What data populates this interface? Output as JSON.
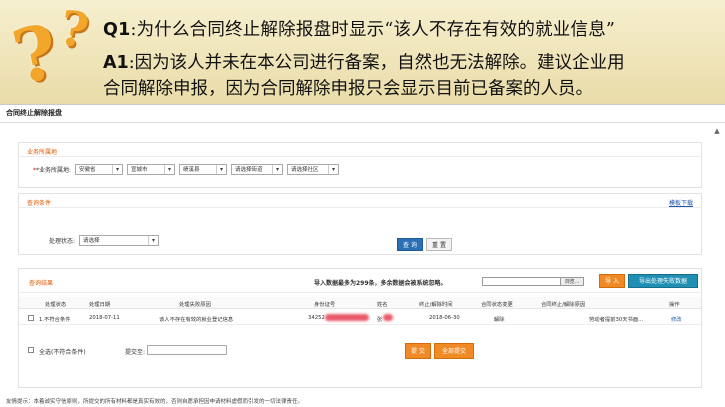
{
  "banner": {
    "q1_tag": "Q1",
    "q1_text": ":为什么合同终止解除报盘时显示“该人不存在有效的就业信息”",
    "a1_tag": "A1",
    "a1_text": ":因为该人并未在本公司进行备案，自然也无法解除。建议企业用",
    "a1_text2": "合同解除申报，因为合同解除申报只会显示目前已备案的人员。",
    "qmark": "?"
  },
  "page": {
    "tab_title": "合同终止解除报盘",
    "service_area": {
      "title": "业务所属地",
      "label": "*业务所属地:",
      "province": "安徽省",
      "city": "宣城市",
      "county": "绩溪县",
      "street_placeholder": "请选择街道",
      "community_placeholder": "请选择社区"
    },
    "query": {
      "title": "查询条件",
      "template_link": "模板下载",
      "status_label": "处理状态:",
      "status_value": "请选择",
      "query_button": "查 询",
      "reset_button": "重 置"
    },
    "results": {
      "title": "查询结果",
      "import_notice": "导入数据最多为299条，多余数据会被系统忽略。",
      "browse_button": "浏览...",
      "import_button": "导 入",
      "export_fail_button": "导出处理失败数据",
      "columns": [
        "处理状态",
        "处理日期",
        "处理失败原因",
        "身份证号",
        "姓名",
        "终止/解除时间",
        "合同状态变更",
        "合同终止/解除原因",
        "操作"
      ],
      "rows": [
        {
          "status": "1.不符合条件",
          "date": "2018-07-11",
          "reason": "该人不存在有效的就业登记信息",
          "id_prefix": "34252",
          "name_prefix": "张",
          "end_date": "2018-06-30",
          "change": "解除",
          "contract_reason": "劳动者提前30天书面...",
          "action": "修改"
        }
      ],
      "select_all_label": "全选(不符合条件)",
      "submit_date_label": "提交至:",
      "submit_button": "提 交",
      "submit_all_button": "全部提交"
    },
    "footer_note": "友情提示：本着诚实守信原则，所提交的所有材料都是真实有效的，否则自愿承担因申请材料虚假而引发的一切法律责任。"
  }
}
